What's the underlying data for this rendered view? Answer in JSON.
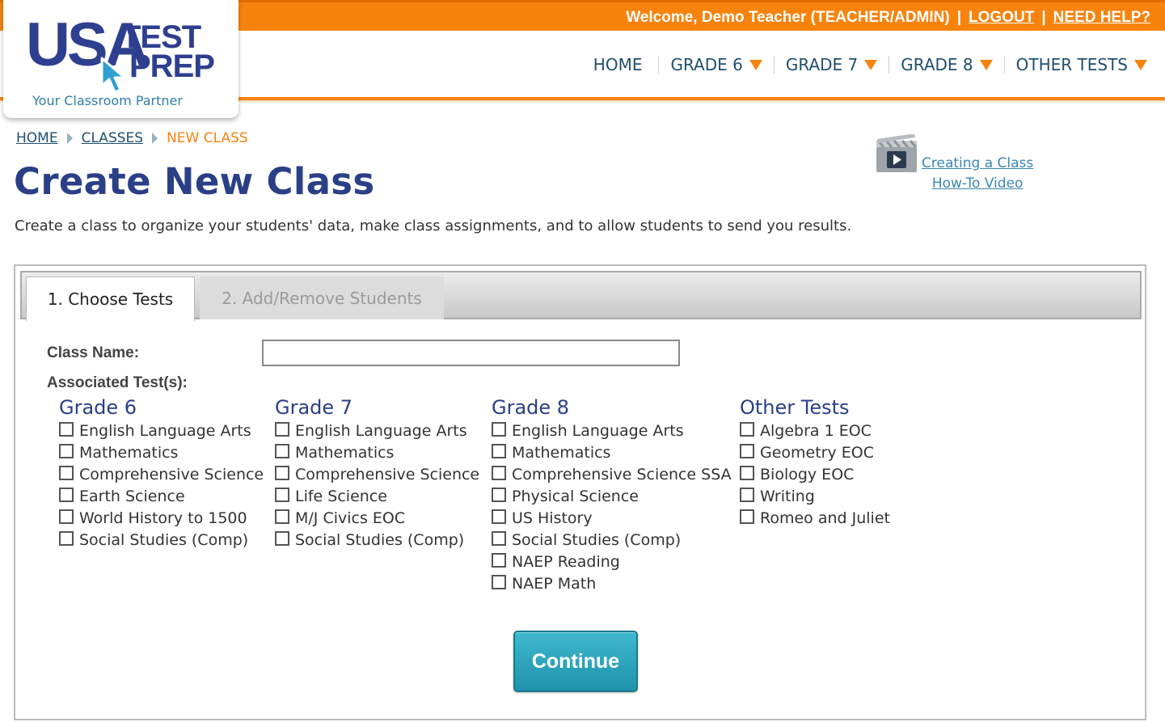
{
  "topbar": {
    "welcome": "Welcome, Demo Teacher (TEACHER/ADMIN)",
    "logout": "LOGOUT",
    "help": "NEED HELP?",
    "separator": "|"
  },
  "logo": {
    "usa": "USA",
    "test": "TEST",
    "prep": "PREP",
    "tagline": "Your Classroom Partner"
  },
  "nav": {
    "home": "HOME",
    "grade6": "GRADE 6",
    "grade7": "GRADE 7",
    "grade8": "GRADE 8",
    "other": "OTHER TESTS"
  },
  "breadcrumb": {
    "home": "HOME",
    "classes": "CLASSES",
    "current": "NEW CLASS"
  },
  "page": {
    "title": "Create New Class",
    "description": "Create a class to organize your students' data, make class assignments, and to allow students to send you results."
  },
  "video": {
    "line1": "Creating a Class",
    "line2": "How-To Video"
  },
  "tabs": {
    "choose": "1. Choose Tests",
    "students": "2. Add/Remove Students"
  },
  "form": {
    "class_name_label": "Class Name:",
    "class_name_value": "",
    "tests_label": "Associated Test(s):",
    "continue": "Continue"
  },
  "columns": [
    {
      "heading": "Grade 6",
      "items": [
        "English Language Arts",
        "Mathematics",
        "Comprehensive Science",
        "Earth Science",
        "World History to 1500",
        "Social Studies (Comp)"
      ]
    },
    {
      "heading": "Grade 7",
      "items": [
        "English Language Arts",
        "Mathematics",
        "Comprehensive Science",
        "Life Science",
        "M/J Civics EOC",
        "Social Studies (Comp)"
      ]
    },
    {
      "heading": "Grade 8",
      "items": [
        "English Language Arts",
        "Mathematics",
        "Comprehensive Science SSA",
        "Physical Science",
        "US History",
        "Social Studies (Comp)",
        "NAEP Reading",
        "NAEP Math"
      ]
    },
    {
      "heading": "Other Tests",
      "items": [
        "Algebra 1 EOC",
        "Geometry EOC",
        "Biology EOC",
        "Writing",
        "Romeo and Juliet"
      ]
    }
  ],
  "colors": {
    "brand_orange": "#f7830d",
    "brand_navy": "#2a3f86",
    "button_teal": "#1f93ac",
    "link_blue": "#3a86b4"
  }
}
